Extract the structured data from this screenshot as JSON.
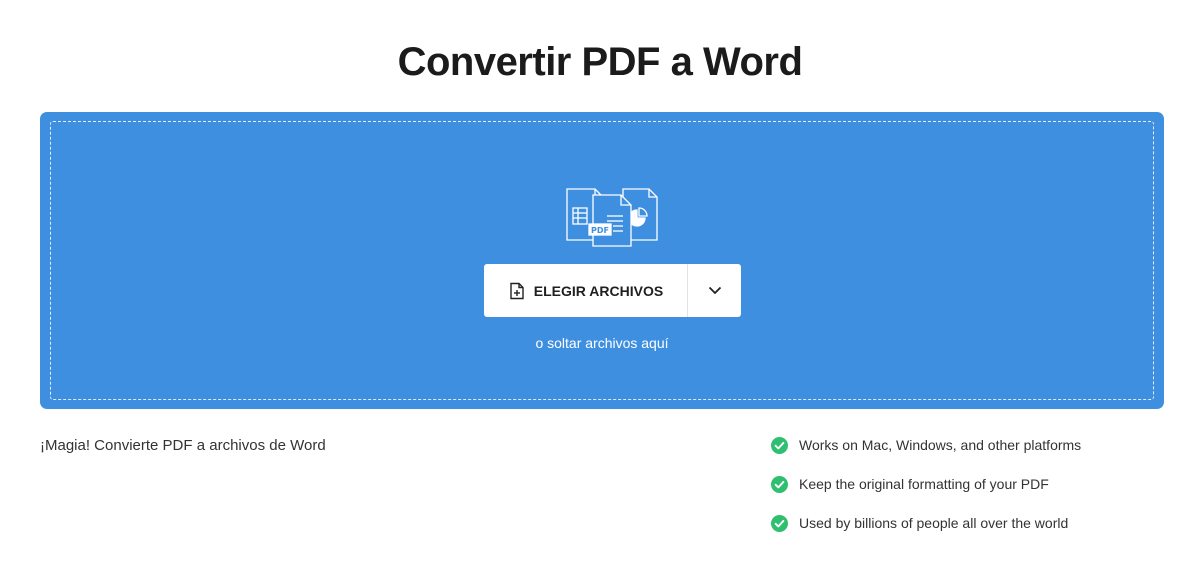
{
  "page": {
    "title": "Convertir PDF a Word",
    "subtitle": "¡Magia! Convierte PDF a archivos de Word"
  },
  "dropzone": {
    "choose_label": "ELEGIR ARCHIVOS",
    "choose_icon": "file-add-icon",
    "dropdown_icon": "chevron-down-icon",
    "drop_hint": "o soltar archivos aquí",
    "illustration_badge": "PDF",
    "background_color": "#3e8fe0"
  },
  "features": [
    {
      "text": "Works on Mac, Windows, and other platforms",
      "icon": "check-circle-icon"
    },
    {
      "text": "Keep the original formatting of your PDF",
      "icon": "check-circle-icon"
    },
    {
      "text": "Used by billions of people all over the world",
      "icon": "check-circle-icon"
    }
  ],
  "colors": {
    "accent_blue": "#3e8fe0",
    "check_green": "#2fbf71"
  }
}
